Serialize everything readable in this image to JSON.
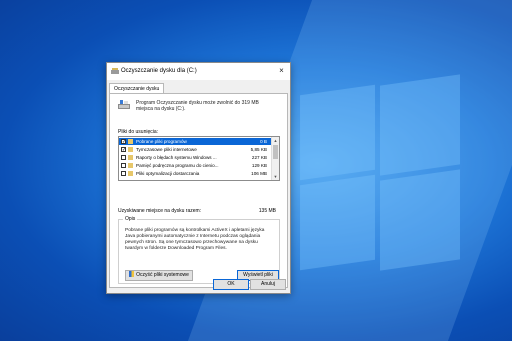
{
  "window": {
    "title": "Oczyszczanie dysku dla  (C:)",
    "close_glyph": "×"
  },
  "tabs": [
    "Oczyszczanie dysku"
  ],
  "description": "Program Oczyszczanie dysku może zwolnić do 319 MB miejsca na dysku  (C:).",
  "files_label": "Pliki do usunięcia:",
  "files": [
    {
      "checked": true,
      "name": "Pobrane pliki programów",
      "size": "0 B",
      "selected": true,
      "icon": "folder-icon"
    },
    {
      "checked": true,
      "name": "Tymczasowe pliki internetowe",
      "size": "5,85 KB",
      "selected": false,
      "icon": "lock-icon"
    },
    {
      "checked": false,
      "name": "Raporty o błędach systemu Windows ...",
      "size": "227 KB",
      "selected": false,
      "icon": "folder-icon"
    },
    {
      "checked": false,
      "name": "Pamięć podręczna programu do cienio...",
      "size": "129 KB",
      "selected": false,
      "icon": "folder-icon"
    },
    {
      "checked": false,
      "name": "Pliki optymalizacji dostarczania",
      "size": "106 MB",
      "selected": false,
      "icon": "folder-icon"
    }
  ],
  "gain": {
    "label": "Uzyskiwane miejsce na dysku razem:",
    "value": "135 MB"
  },
  "group": {
    "title": "Opis",
    "text": "Pobrane pliki programów są kontrolkami ActiveX i apletami języka Java pobieranymi automatycznie z Internetu podczas oglądania pewnych stron. Są one tymczasowo przechowywane na dysku twardym w folderze Downloaded Program Files."
  },
  "buttons": {
    "cleanup_system": "Oczyść pliki systemowe",
    "view_files": "Wyświetl pliki",
    "ok": "OK",
    "cancel": "Anuluj"
  },
  "colors": {
    "selection": "#0a66d6",
    "desktop": "#1f78da"
  }
}
